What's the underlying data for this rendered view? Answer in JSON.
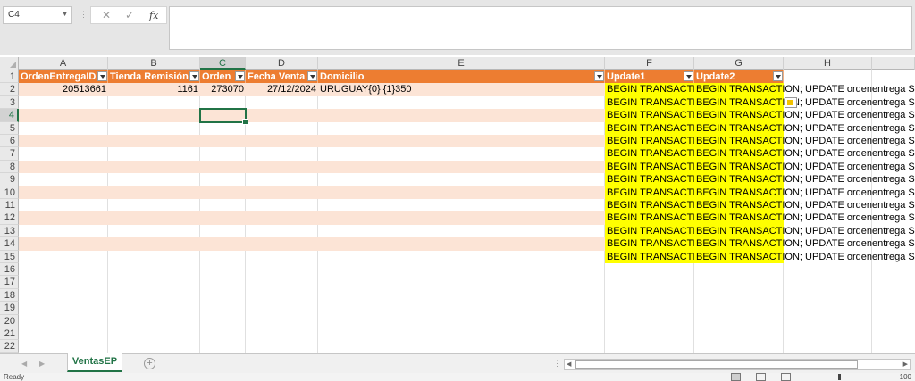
{
  "formula_bar": {
    "name_box": "C4",
    "cancel_glyph": "✕",
    "enter_glyph": "✓",
    "fx_label": "fx",
    "formula": ""
  },
  "columns": [
    "A",
    "B",
    "C",
    "D",
    "E",
    "F",
    "G",
    "H"
  ],
  "selected_column": "C",
  "rows": [
    "1",
    "2",
    "3",
    "4",
    "5",
    "6",
    "7",
    "8",
    "9",
    "10",
    "11",
    "12",
    "13",
    "14",
    "15",
    "16",
    "17",
    "18",
    "19",
    "20",
    "21",
    "22"
  ],
  "selected_row": "4",
  "table": {
    "headers": [
      "OrdenEntregaID",
      "Tienda Remisión",
      "Orden",
      "Fecha Venta",
      "Domicilio",
      "Update1",
      "Update2"
    ],
    "row2": {
      "a": "20513661",
      "b": "1161",
      "c": "273070",
      "d": "27/12/2024",
      "e": "URUGUAY{0} {1}350"
    },
    "update1_text": "BEGIN TRANSACTION",
    "update2_text": "BEGIN TRANSACTION; UPDATE ordenentrega SET"
  },
  "colors": {
    "header_fill": "#ed7d31",
    "band_fill": "#fce4d6",
    "highlight": "#ffff00",
    "excel_green": "#217346"
  },
  "sheet_tabs": [
    {
      "label": "VentasEP",
      "active": true
    }
  ],
  "add_sheet_glyph": "+",
  "status": {
    "text": "Ready",
    "zoom": "100"
  }
}
